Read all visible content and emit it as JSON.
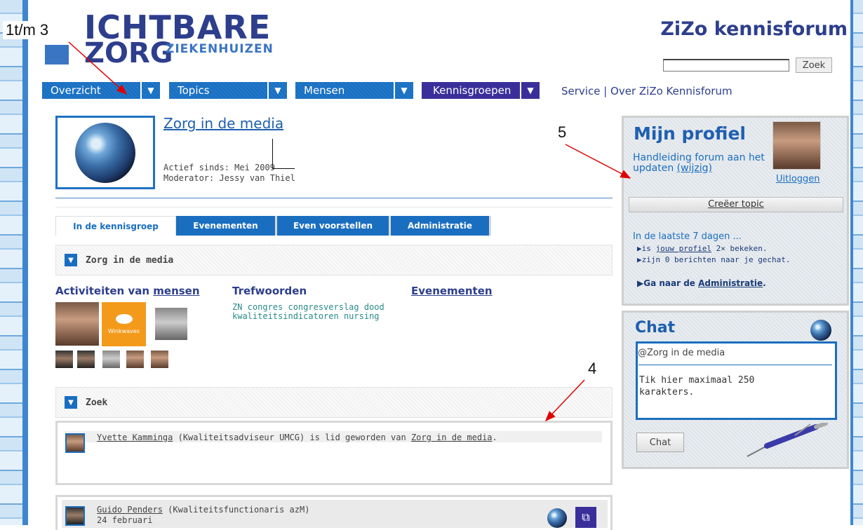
{
  "logo": {
    "line1": "ICHTBARE",
    "line2": "ZORG",
    "sub": "ZIEKENHUIZEN"
  },
  "annotations": {
    "a1": "1t/m 3",
    "a4": "4",
    "a5": "5"
  },
  "header": {
    "forum_title": "ZiZo kennisforum",
    "search_placeholder": "",
    "search_button": "Zoek"
  },
  "nav": {
    "items": [
      {
        "label": "Overzicht"
      },
      {
        "label": "Topics"
      },
      {
        "label": "Mensen"
      },
      {
        "label": "Kennisgroepen"
      }
    ],
    "arrow": "▼",
    "links": "Service | Over ZiZo Kennisforum"
  },
  "group": {
    "title": "Zorg in de media",
    "active_since": "Actief sinds: Mei 2009",
    "moderator": "Moderator: Jessy van Thiel"
  },
  "tabs": [
    {
      "label": "In de kennisgroep"
    },
    {
      "label": "Evenementen"
    },
    {
      "label": "Even voorstellen"
    },
    {
      "label": "Administratie"
    }
  ],
  "sections": {
    "group_label": "Zorg in de media",
    "search_label": "Zoek"
  },
  "columns": {
    "activities_prefix": "Activiteiten van ",
    "activities_link": "mensen",
    "keywords": "Trefwoorden",
    "events": "Evenementen",
    "tags_line1": "ZN congres congresverslag dood",
    "tags_line2": "kwaliteitsindicatoren nursing"
  },
  "winkwaves": "Winkwaves",
  "activity": [
    {
      "name": "Yvette Kamminga",
      "role": " (Kwaliteitsadviseur UMCG) is lid geworden van ",
      "target": "Zorg in de media",
      "end": "."
    },
    {
      "name": "Guido Penders",
      "role": " (Kwaliteitsfunctionaris azM)",
      "date": "24 februari"
    }
  ],
  "profile": {
    "title": "Mijn profiel",
    "status_text": "Handleiding forum aan het updaten ",
    "status_edit": "(wijzig)",
    "logout": "Uitloggen",
    "create_topic": "Creëer topic",
    "stats_intro": "In de laatste 7 dagen ...",
    "stat1_prefix": "is ",
    "stat1_link": "jouw profiel",
    "stat1_suffix": " 2× bekeken.",
    "stat2": "zijn 0 berichten naar je gechat.",
    "admin_prefix": "Ga naar de ",
    "admin_link": "Administratie",
    "admin_suffix": "."
  },
  "chat": {
    "title": "Chat",
    "context": "@Zorg in de media",
    "placeholder_line1": "Tik hier maximaal 250",
    "placeholder_line2": "karakters.",
    "button": "Chat"
  },
  "colors": {
    "brand": "#2d3e8c",
    "nav_blue": "#1a6ec0",
    "nav_purple": "#3a2f9a",
    "annotation_arrow": "#e00000"
  }
}
